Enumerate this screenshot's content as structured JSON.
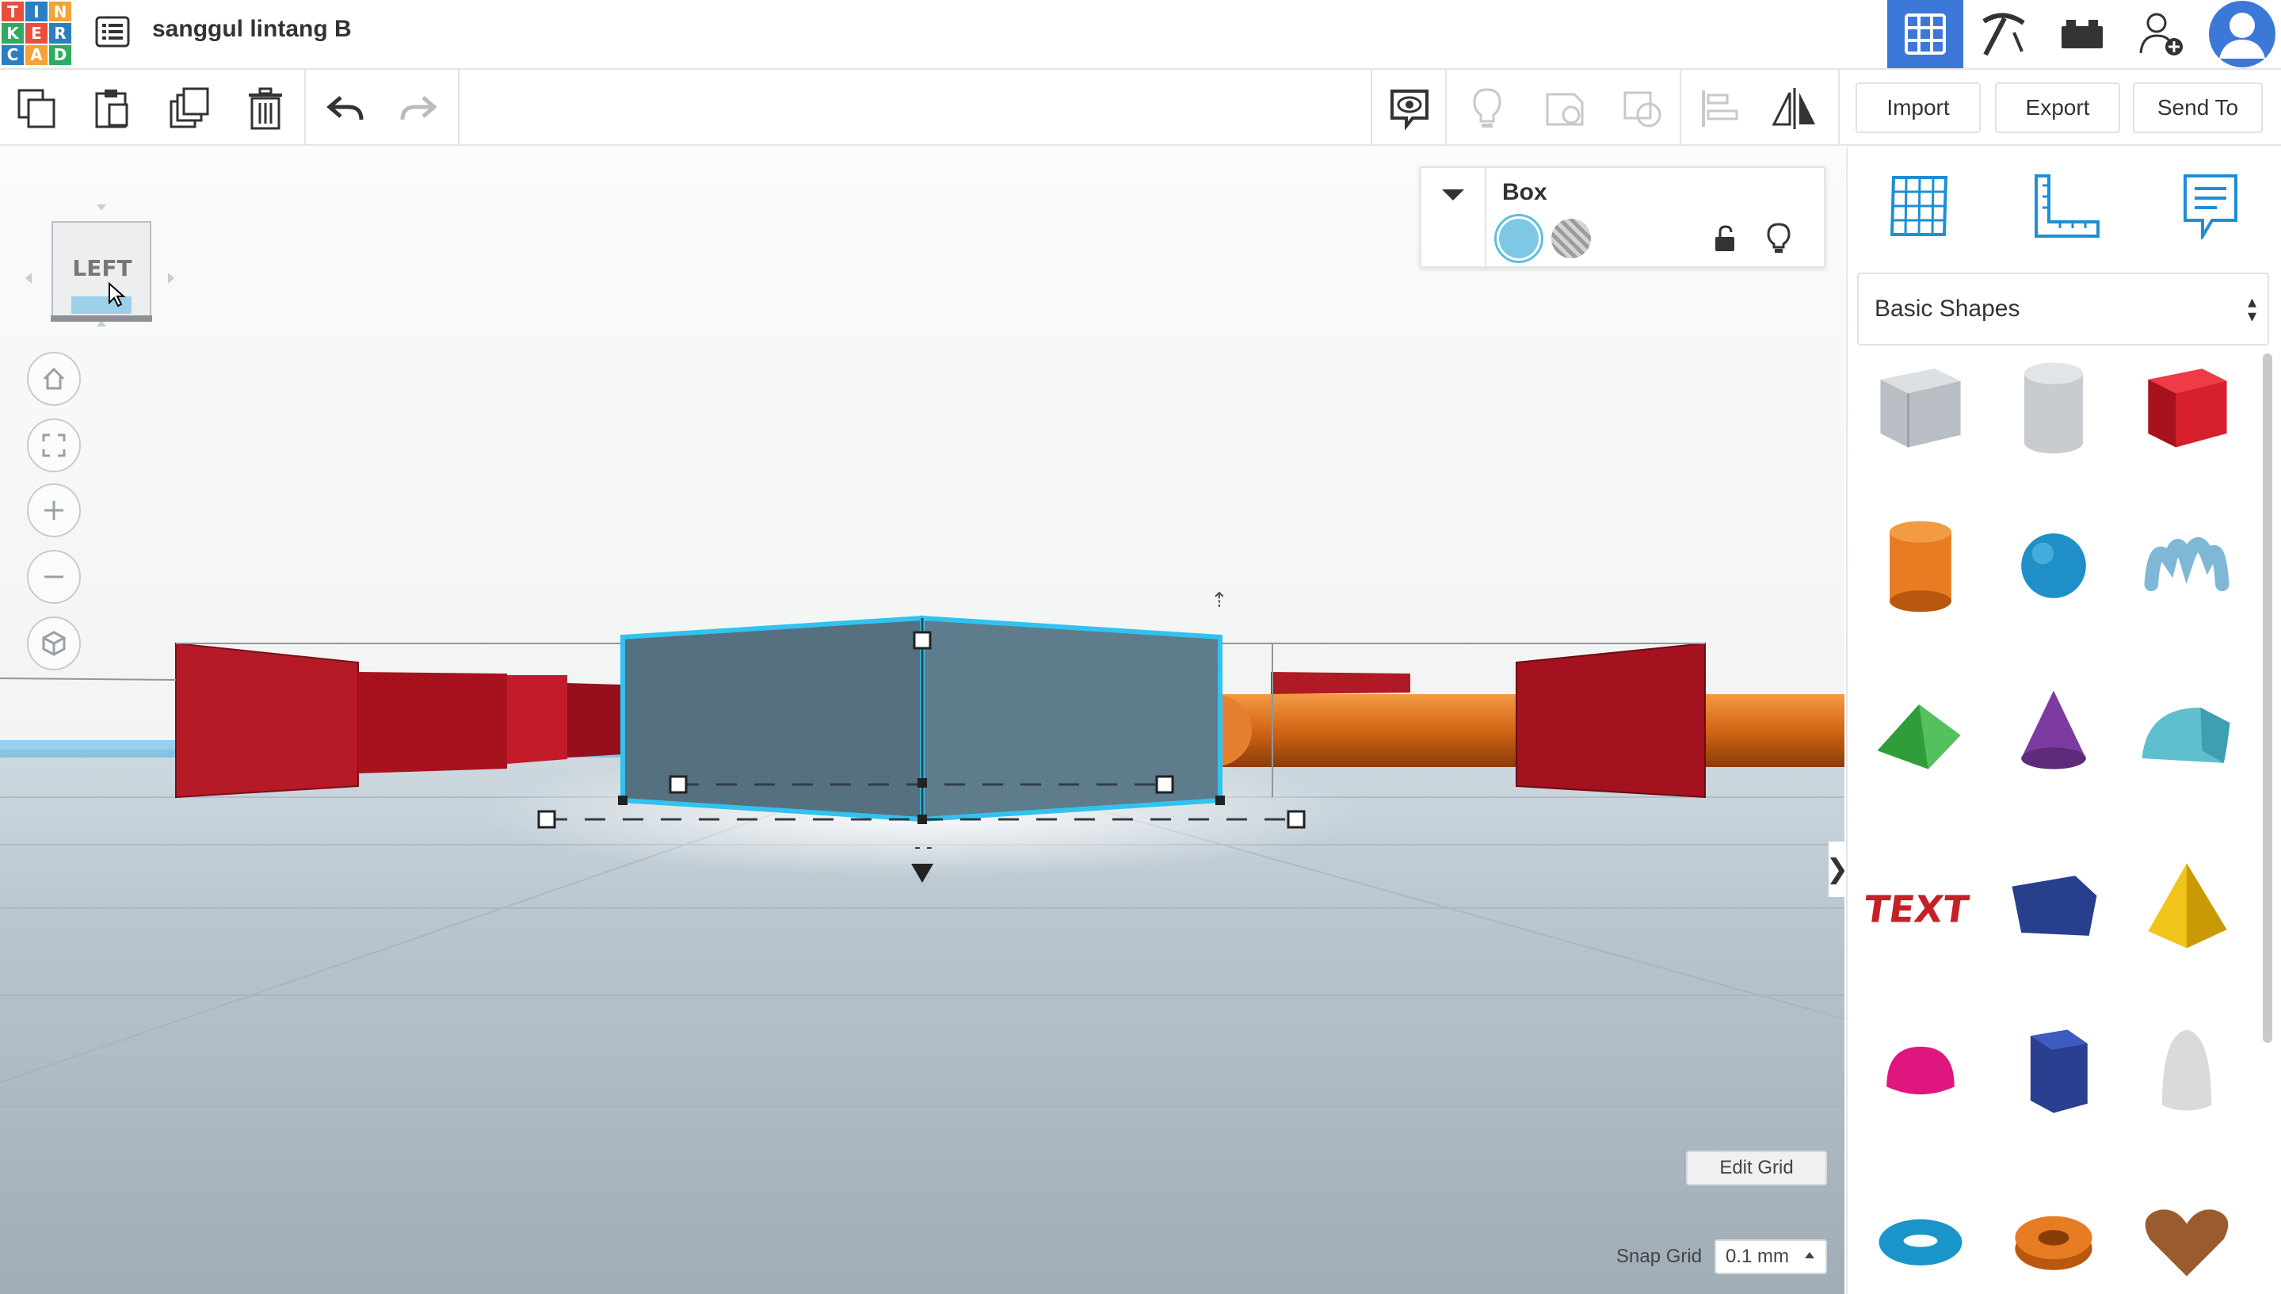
{
  "app": {
    "logo_letters": [
      "T",
      "I",
      "N",
      "K",
      "E",
      "R",
      "C",
      "A",
      "D"
    ],
    "logo_colors": [
      "#e94f3d",
      "#2b7ec1",
      "#f2a33a",
      "#2eac60",
      "#e94f3d",
      "#2b7ec1",
      "#2b7ec1",
      "#f2a33a",
      "#2eac60"
    ],
    "design_title": "sanggul lintang B",
    "accent_color": "#3c78d8"
  },
  "topbar": {
    "icons": [
      "design-list-icon",
      "grid-3d-view-icon",
      "pickaxe-icon",
      "bricks-icon",
      "add-user-icon",
      "profile-avatar-icon"
    ],
    "active_view": "grid-3d-view"
  },
  "toolbar": {
    "tools": [
      "copy-icon",
      "paste-icon",
      "duplicate-icon",
      "delete-icon",
      "undo-icon",
      "redo-icon"
    ],
    "view_tools": [
      "show-all-icon",
      "hide-light-icon",
      "group-icon",
      "ungroup-icon",
      "align-icon",
      "mirror-icon"
    ],
    "import_label": "Import",
    "export_label": "Export",
    "send_to_label": "Send To"
  },
  "viewport": {
    "viewcube_label": "LEFT",
    "nav_buttons": [
      "home-view-icon",
      "fit-view-icon",
      "zoom-in-icon",
      "zoom-out-icon",
      "ortho-view-icon"
    ],
    "edit_grid_label": "Edit Grid",
    "snap_grid_label": "Snap Grid",
    "snap_grid_value": "0.1 mm",
    "panel_toggle_glyph": "❯"
  },
  "inspector": {
    "shape_name": "Box",
    "solid_color": "#7ec8e3",
    "mode": "solid"
  },
  "right_panel": {
    "tabs": [
      "workplane-grid-icon",
      "ruler-icon",
      "notes-icon"
    ],
    "category_label": "Basic Shapes",
    "shapes": [
      {
        "name": "box-hole",
        "color": "#b9bec4"
      },
      {
        "name": "cylinder-hole",
        "color": "#c8ccd0"
      },
      {
        "name": "box",
        "color": "#d6202d"
      },
      {
        "name": "cylinder",
        "color": "#e77c22"
      },
      {
        "name": "sphere",
        "color": "#1f8fc8"
      },
      {
        "name": "scribble",
        "color": "#7fb8d6"
      },
      {
        "name": "roof",
        "color": "#2f9e3a"
      },
      {
        "name": "cone",
        "color": "#7d3aa0"
      },
      {
        "name": "round-roof",
        "color": "#5fbfcf"
      },
      {
        "name": "text",
        "color": "#c62027"
      },
      {
        "name": "wedge",
        "color": "#273f8c"
      },
      {
        "name": "pyramid",
        "color": "#f0c419"
      },
      {
        "name": "half-sphere",
        "color": "#e0167f"
      },
      {
        "name": "polygon",
        "color": "#2a3f8f"
      },
      {
        "name": "paraboloid",
        "color": "#d8dadc"
      },
      {
        "name": "torus",
        "color": "#1a95c9"
      },
      {
        "name": "tube",
        "color": "#e77c22"
      },
      {
        "name": "heart",
        "color": "#9a5c2f"
      }
    ]
  }
}
